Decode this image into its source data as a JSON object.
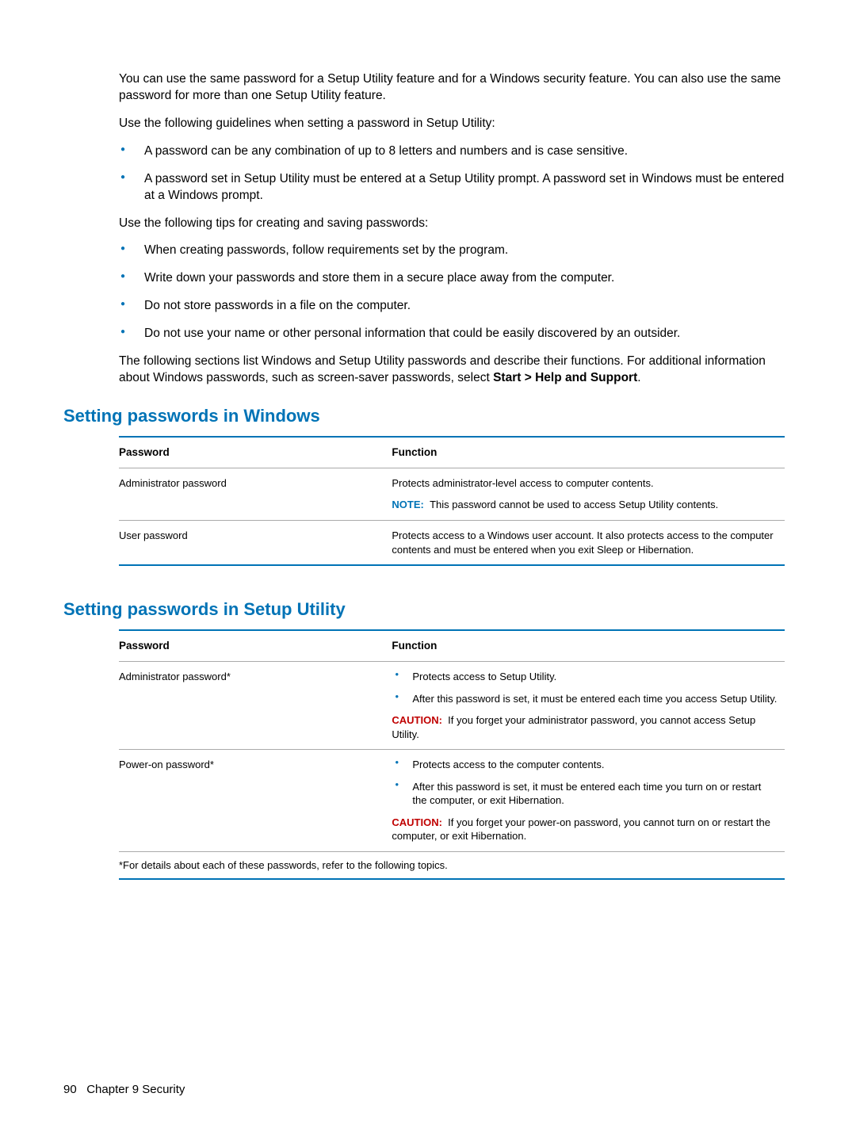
{
  "intro": {
    "p1": "You can use the same password for a Setup Utility feature and for a Windows security feature. You can also use the same password for more than one Setup Utility feature.",
    "p2": "Use the following guidelines when setting a password in Setup Utility:",
    "guidelines": [
      "A password can be any combination of up to 8 letters and numbers and is case sensitive.",
      "A password set in Setup Utility must be entered at a Setup Utility prompt. A password set in Windows must be entered at a Windows prompt."
    ],
    "p3": "Use the following tips for creating and saving passwords:",
    "tips": [
      "When creating passwords, follow requirements set by the program.",
      "Write down your passwords and store them in a secure place away from the computer.",
      "Do not store passwords in a file on the computer.",
      "Do not use your name or other personal information that could be easily discovered by an outsider."
    ],
    "p4_a": "The following sections list Windows and Setup Utility passwords and describe their functions. For additional information about Windows passwords, such as screen-saver passwords, select ",
    "p4_b": "Start > Help and Support",
    "p4_c": "."
  },
  "section1": {
    "title": "Setting passwords in Windows",
    "header_password": "Password",
    "header_function": "Function",
    "rows": [
      {
        "password": "Administrator password",
        "function_main": "Protects administrator-level access to computer contents.",
        "note_label": "NOTE:",
        "note_text": "This password cannot be used to access Setup Utility contents."
      },
      {
        "password": "User password",
        "function_main": "Protects access to a Windows user account. It also protects access to the computer contents and must be entered when you exit Sleep or Hibernation."
      }
    ]
  },
  "section2": {
    "title": "Setting passwords in Setup Utility",
    "header_password": "Password",
    "header_function": "Function",
    "rows": [
      {
        "password": "Administrator password*",
        "bullets": [
          "Protects access to Setup Utility.",
          "After this password is set, it must be entered each time you access Setup Utility."
        ],
        "caution_label": "CAUTION:",
        "caution_text": "If you forget your administrator password, you cannot access Setup Utility."
      },
      {
        "password": "Power-on password*",
        "bullets": [
          "Protects access to the computer contents.",
          "After this password is set, it must be entered each time you turn on or restart the computer, or exit Hibernation."
        ],
        "caution_label": "CAUTION:",
        "caution_text": "If you forget your power-on password, you cannot turn on or restart the computer, or exit Hibernation."
      }
    ],
    "footnote": "*For details about each of these passwords, refer to the following topics."
  },
  "footer": {
    "page_number": "90",
    "chapter": "Chapter 9   Security"
  }
}
